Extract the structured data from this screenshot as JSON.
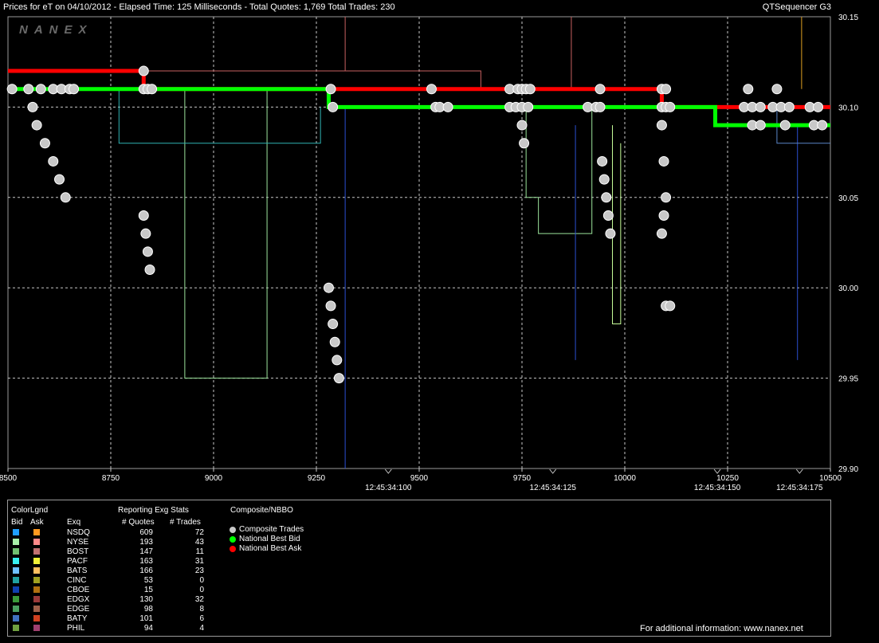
{
  "header": {
    "title": "Prices for  eT  on  04/10/2012  -  Elapsed Time: 125 Milliseconds  -  Total Quotes: 1,769  Total Trades: 230",
    "app_name": "QTSequencer G3",
    "watermark": "NANEX"
  },
  "chart_data": {
    "type": "line",
    "title": "",
    "xlabel": "",
    "ylabel": "",
    "xlim": [
      8500,
      10500
    ],
    "ylim": [
      29.9,
      30.15
    ],
    "x_ticks": [
      8500,
      8750,
      9000,
      9250,
      9500,
      9750,
      10000,
      10250,
      10500
    ],
    "x_tick_labels": [
      "8500",
      "8750",
      "9000",
      "9250",
      "9500",
      "9750",
      "10000",
      "10250",
      "10500"
    ],
    "time_marks": [
      {
        "x": 9425,
        "label": "12:45:34:100"
      },
      {
        "x": 9825,
        "label": "12:45:34:125"
      },
      {
        "x": 10225,
        "label": "12:45:34:150"
      },
      {
        "x": 10425,
        "label": "12:45:34:175"
      }
    ],
    "y_ticks": [
      29.9,
      29.95,
      30.0,
      30.05,
      30.1,
      30.15
    ],
    "y_tick_labels": [
      "29.90",
      "29.95",
      "30.00",
      "30.05",
      "30.10",
      "30.15"
    ],
    "grid": true,
    "national_best_ask": [
      [
        8500,
        30.12
      ],
      [
        8830,
        30.12
      ],
      [
        8830,
        30.11
      ],
      [
        9770,
        30.11
      ],
      [
        9770,
        30.11
      ],
      [
        10090,
        30.11
      ],
      [
        10090,
        30.1
      ],
      [
        10500,
        30.1
      ]
    ],
    "national_best_bid": [
      [
        8500,
        30.11
      ],
      [
        9280,
        30.11
      ],
      [
        9280,
        30.1
      ],
      [
        10090,
        30.1
      ],
      [
        10090,
        30.1
      ],
      [
        10220,
        30.1
      ],
      [
        10220,
        30.09
      ],
      [
        10500,
        30.09
      ]
    ],
    "exchange_lines": [
      {
        "color": "#9be39b",
        "points": [
          [
            8930,
            30.11
          ],
          [
            8930,
            29.95
          ],
          [
            9130,
            29.95
          ],
          [
            9130,
            30.11
          ]
        ]
      },
      {
        "color": "#2fb3b3",
        "points": [
          [
            8770,
            30.11
          ],
          [
            8770,
            30.08
          ],
          [
            9260,
            30.08
          ],
          [
            9260,
            30.1
          ]
        ]
      },
      {
        "color": "#9be39b",
        "points": [
          [
            9760,
            30.1
          ],
          [
            9760,
            30.05
          ],
          [
            9790,
            30.05
          ],
          [
            9790,
            30.03
          ],
          [
            9920,
            30.03
          ],
          [
            9920,
            30.1
          ]
        ]
      },
      {
        "color": "#c8ff9a",
        "points": [
          [
            9970,
            30.09
          ],
          [
            9970,
            29.98
          ],
          [
            9990,
            29.98
          ],
          [
            9990,
            30.08
          ]
        ]
      },
      {
        "color": "#2b4fd1",
        "points": [
          [
            9320,
            30.1
          ],
          [
            9320,
            29.9
          ]
        ]
      },
      {
        "color": "#2b4fd1",
        "points": [
          [
            9880,
            30.09
          ],
          [
            9880,
            29.96
          ]
        ]
      },
      {
        "color": "#2b4fd1",
        "points": [
          [
            10420,
            30.09
          ],
          [
            10420,
            29.96
          ]
        ]
      },
      {
        "color": "#e0a020",
        "points": [
          [
            10430,
            30.15
          ],
          [
            10430,
            30.11
          ]
        ]
      },
      {
        "color": "#c86060",
        "points": [
          [
            8830,
            30.12
          ],
          [
            9320,
            30.12
          ],
          [
            9320,
            30.15
          ]
        ]
      },
      {
        "color": "#c86060",
        "points": [
          [
            9320,
            30.12
          ],
          [
            9650,
            30.12
          ],
          [
            9650,
            30.11
          ]
        ]
      },
      {
        "color": "#c86060",
        "points": [
          [
            9870,
            30.11
          ],
          [
            9870,
            30.15
          ]
        ]
      },
      {
        "color": "#5a86c7",
        "points": [
          [
            10370,
            30.1
          ],
          [
            10370,
            30.08
          ],
          [
            10500,
            30.08
          ]
        ]
      }
    ],
    "composite_trades": [
      [
        8510,
        30.11
      ],
      [
        8550,
        30.11
      ],
      [
        8580,
        30.11
      ],
      [
        8610,
        30.11
      ],
      [
        8630,
        30.11
      ],
      [
        8650,
        30.11
      ],
      [
        8660,
        30.11
      ],
      [
        8560,
        30.1
      ],
      [
        8570,
        30.09
      ],
      [
        8590,
        30.08
      ],
      [
        8610,
        30.07
      ],
      [
        8625,
        30.06
      ],
      [
        8640,
        30.05
      ],
      [
        8830,
        30.12
      ],
      [
        8830,
        30.11
      ],
      [
        8840,
        30.11
      ],
      [
        8850,
        30.11
      ],
      [
        8830,
        30.04
      ],
      [
        8835,
        30.03
      ],
      [
        8840,
        30.02
      ],
      [
        8845,
        30.01
      ],
      [
        9285,
        30.11
      ],
      [
        9290,
        30.1
      ],
      [
        9280,
        30.0
      ],
      [
        9285,
        29.99
      ],
      [
        9290,
        29.98
      ],
      [
        9295,
        29.97
      ],
      [
        9300,
        29.96
      ],
      [
        9305,
        29.95
      ],
      [
        9530,
        30.11
      ],
      [
        9540,
        30.1
      ],
      [
        9550,
        30.1
      ],
      [
        9570,
        30.1
      ],
      [
        9720,
        30.11
      ],
      [
        9740,
        30.11
      ],
      [
        9750,
        30.11
      ],
      [
        9760,
        30.11
      ],
      [
        9770,
        30.11
      ],
      [
        9720,
        30.1
      ],
      [
        9735,
        30.1
      ],
      [
        9750,
        30.1
      ],
      [
        9765,
        30.1
      ],
      [
        9750,
        30.09
      ],
      [
        9755,
        30.08
      ],
      [
        9910,
        30.1
      ],
      [
        9930,
        30.1
      ],
      [
        9940,
        30.1
      ],
      [
        9940,
        30.11
      ],
      [
        9945,
        30.07
      ],
      [
        9950,
        30.06
      ],
      [
        9955,
        30.05
      ],
      [
        9960,
        30.04
      ],
      [
        9965,
        30.03
      ],
      [
        10090,
        30.11
      ],
      [
        10100,
        30.11
      ],
      [
        10090,
        30.1
      ],
      [
        10100,
        30.1
      ],
      [
        10110,
        30.1
      ],
      [
        10090,
        30.09
      ],
      [
        10095,
        30.07
      ],
      [
        10100,
        30.05
      ],
      [
        10095,
        30.04
      ],
      [
        10090,
        30.03
      ],
      [
        10100,
        29.99
      ],
      [
        10110,
        29.99
      ],
      [
        10300,
        30.11
      ],
      [
        10370,
        30.11
      ],
      [
        10290,
        30.1
      ],
      [
        10310,
        30.1
      ],
      [
        10330,
        30.1
      ],
      [
        10360,
        30.1
      ],
      [
        10380,
        30.1
      ],
      [
        10400,
        30.1
      ],
      [
        10450,
        30.1
      ],
      [
        10470,
        30.1
      ],
      [
        10310,
        30.09
      ],
      [
        10330,
        30.09
      ],
      [
        10390,
        30.09
      ],
      [
        10460,
        30.09
      ],
      [
        10480,
        30.09
      ]
    ]
  },
  "legend": {
    "colorlgnd": "ColorLgnd",
    "bid_header": "Bid",
    "ask_header": "Ask",
    "exq_header": "Exq",
    "stats_title": "Reporting Exg Stats",
    "quotes_header": "# Quotes",
    "trades_header": "# Trades",
    "composite_title": "Composite/NBBO",
    "composite_trades_label": "Composite Trades",
    "national_best_bid_label": "National Best Bid",
    "national_best_ask_label": "National Best Ask",
    "composite_trades_color": "#c8c8c8",
    "national_best_bid_color": "#00ff00",
    "national_best_ask_color": "#ff0000",
    "footer": "For additional information: www.nanex.net",
    "exchanges": [
      {
        "name": "NSDQ",
        "quotes": "609",
        "trades": "72",
        "bid_color": "#1fa0ff",
        "ask_color": "#ff9a1f"
      },
      {
        "name": "NYSE",
        "quotes": "193",
        "trades": "43",
        "bid_color": "#a8f0a8",
        "ask_color": "#ff8a8a"
      },
      {
        "name": "BOST",
        "quotes": "147",
        "trades": "11",
        "bid_color": "#70c070",
        "ask_color": "#c07070"
      },
      {
        "name": "PACF",
        "quotes": "163",
        "trades": "31",
        "bid_color": "#38f0f0",
        "ask_color": "#f0f038"
      },
      {
        "name": "BATS",
        "quotes": "166",
        "trades": "23",
        "bid_color": "#6fc0ff",
        "ask_color": "#ffc060"
      },
      {
        "name": "CINC",
        "quotes": "53",
        "trades": "0",
        "bid_color": "#20a0a0",
        "ask_color": "#a0a020"
      },
      {
        "name": "CBOE",
        "quotes": "15",
        "trades": "0",
        "bid_color": "#1040b0",
        "ask_color": "#b07010"
      },
      {
        "name": "EDGX",
        "quotes": "130",
        "trades": "32",
        "bid_color": "#3a9a3a",
        "ask_color": "#9a3a3a"
      },
      {
        "name": "EDGE",
        "quotes": "98",
        "trades": "8",
        "bid_color": "#4aa060",
        "ask_color": "#a0604a"
      },
      {
        "name": "BATY",
        "quotes": "101",
        "trades": "6",
        "bid_color": "#4070c0",
        "ask_color": "#d04020"
      },
      {
        "name": "PHIL",
        "quotes": "94",
        "trades": "4",
        "bid_color": "#70a040",
        "ask_color": "#a04070"
      }
    ]
  }
}
